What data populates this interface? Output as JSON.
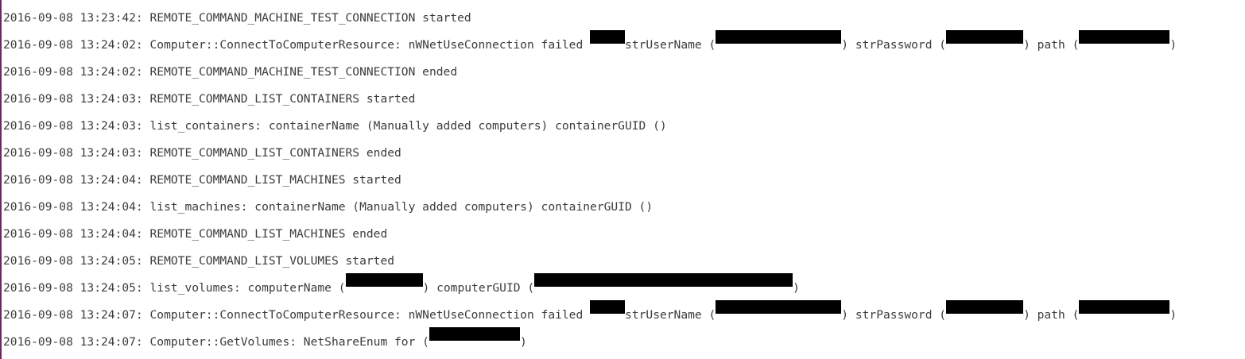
{
  "log": {
    "lines": [
      {
        "segments": [
          {
            "t": "text",
            "text": "2016-09-08 13:23:42: REMOTE_COMMAND_MACHINE_TEST_CONNECTION started"
          }
        ]
      },
      {
        "segments": [
          {
            "t": "text",
            "text": "2016-09-08 13:24:02: Computer::ConnectToComputerResource: nWNetUseConnection failed "
          },
          {
            "t": "redact",
            "ch": 5
          },
          {
            "t": "text",
            "text": "strUserName ("
          },
          {
            "t": "redact",
            "ch": 18
          },
          {
            "t": "text",
            "text": ") strPassword ("
          },
          {
            "t": "redact",
            "ch": 11
          },
          {
            "t": "text",
            "text": ") path ("
          },
          {
            "t": "redact",
            "ch": 13
          },
          {
            "t": "text",
            "text": ")"
          }
        ]
      },
      {
        "segments": [
          {
            "t": "text",
            "text": "2016-09-08 13:24:02: REMOTE_COMMAND_MACHINE_TEST_CONNECTION ended"
          }
        ]
      },
      {
        "segments": [
          {
            "t": "text",
            "text": "2016-09-08 13:24:03: REMOTE_COMMAND_LIST_CONTAINERS started"
          }
        ]
      },
      {
        "segments": [
          {
            "t": "text",
            "text": "2016-09-08 13:24:03: list_containers: containerName (Manually added computers) containerGUID ()"
          }
        ]
      },
      {
        "segments": [
          {
            "t": "text",
            "text": "2016-09-08 13:24:03: REMOTE_COMMAND_LIST_CONTAINERS ended"
          }
        ]
      },
      {
        "segments": [
          {
            "t": "text",
            "text": "2016-09-08 13:24:04: REMOTE_COMMAND_LIST_MACHINES started"
          }
        ]
      },
      {
        "segments": [
          {
            "t": "text",
            "text": "2016-09-08 13:24:04: list_machines: containerName (Manually added computers) containerGUID ()"
          }
        ]
      },
      {
        "segments": [
          {
            "t": "text",
            "text": "2016-09-08 13:24:04: REMOTE_COMMAND_LIST_MACHINES ended"
          }
        ]
      },
      {
        "segments": [
          {
            "t": "text",
            "text": "2016-09-08 13:24:05: REMOTE_COMMAND_LIST_VOLUMES started"
          }
        ]
      },
      {
        "segments": [
          {
            "t": "text",
            "text": "2016-09-08 13:24:05: list_volumes: computerName ("
          },
          {
            "t": "redact",
            "ch": 11
          },
          {
            "t": "text",
            "text": ") computerGUID ("
          },
          {
            "t": "redact",
            "ch": 37
          },
          {
            "t": "text",
            "text": ")"
          }
        ]
      },
      {
        "segments": [
          {
            "t": "text",
            "text": "2016-09-08 13:24:07: Computer::ConnectToComputerResource: nWNetUseConnection failed "
          },
          {
            "t": "redact",
            "ch": 5
          },
          {
            "t": "text",
            "text": "strUserName ("
          },
          {
            "t": "redact",
            "ch": 18
          },
          {
            "t": "text",
            "text": ") strPassword ("
          },
          {
            "t": "redact",
            "ch": 11
          },
          {
            "t": "text",
            "text": ") path ("
          },
          {
            "t": "redact",
            "ch": 13
          },
          {
            "t": "text",
            "text": ")"
          }
        ]
      },
      {
        "segments": [
          {
            "t": "text",
            "text": "2016-09-08 13:24:07: Computer::GetVolumes: NetShareEnum for ("
          },
          {
            "t": "redact",
            "ch": 13
          },
          {
            "t": "text",
            "text": ")"
          }
        ]
      }
    ]
  },
  "colors": {
    "text": "#3c3c3c",
    "redaction": "#000000",
    "edge": "#6b2a5c"
  }
}
